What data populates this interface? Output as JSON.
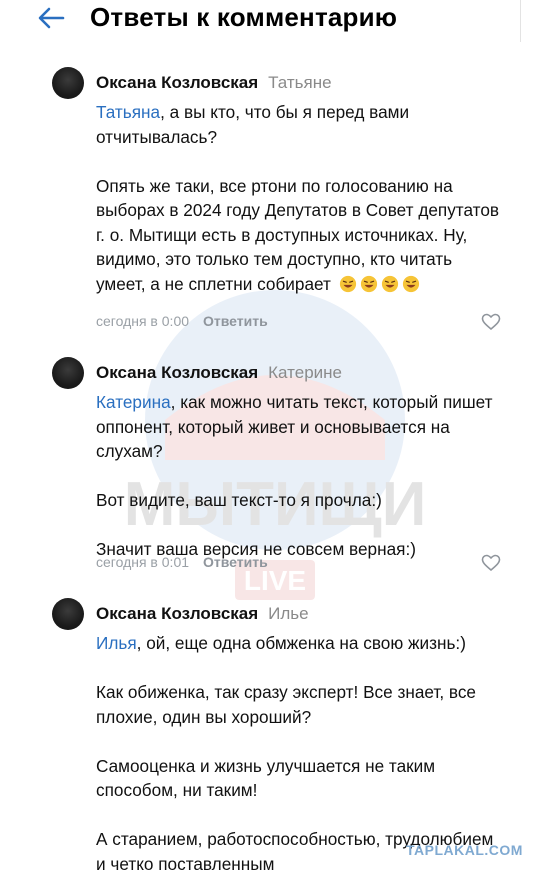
{
  "header": {
    "title": "Ответы к комментарию"
  },
  "watermark": {
    "text": "МЫТИЩИ",
    "sub": "LIVE"
  },
  "comments": [
    {
      "author": "Оксана Козловская",
      "reply_to": "Татьяне",
      "mention": "Татьяна",
      "paragraphs": [
        ", а вы кто, что бы я перед вами отчитывалась?",
        "Опять же таки, все ртони по голосованию на выборах в 2024 году Депутатов в Совет депутатов г. о. Мытищи есть в доступных источниках. Ну, видимо, это только тем доступно, кто читать умеет, а не сплетни собирает"
      ],
      "emoji_count": 4,
      "time": "сегодня в 0:00",
      "reply_label": "Ответить"
    },
    {
      "author": "Оксана Козловская",
      "reply_to": "Катерине",
      "mention": "Катерина",
      "paragraphs": [
        ", как можно читать текст, который пишет оппонент, который живет и основывается на слухам?",
        "Вот видите, ваш текст-то я прочла:)",
        "Значит ваша версия не совсем верная:)"
      ],
      "time": "сегодня в 0:01",
      "reply_label": "Ответить"
    },
    {
      "author": "Оксана Козловская",
      "reply_to": "Илье",
      "mention": "Илья",
      "paragraphs": [
        ", ой, еще одна обмженка на свою жизнь:)",
        "Как обиженка, так сразу эксперт! Все знает, все плохие, один вы хороший?",
        "Самооценка и жизнь улучшается не таким способом, ни таким!",
        "А старанием, работоспособностью, трудолюбием и четко поставленным"
      ]
    }
  ],
  "site_watermark": "TAPLAKAL.COM",
  "colors": {
    "mention": "#2a6fc0",
    "meta": "#9aa0a6",
    "secondary": "#8a8a8a"
  }
}
